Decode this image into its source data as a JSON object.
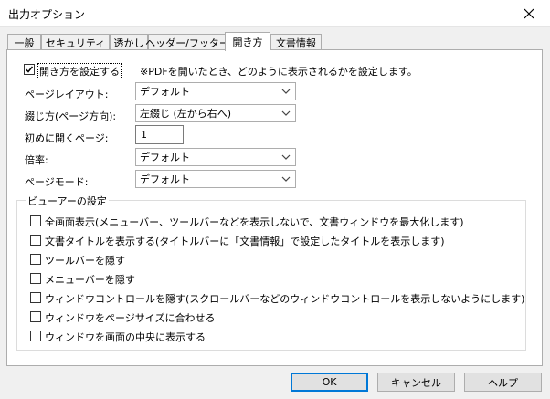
{
  "window": {
    "title": "出力オプション"
  },
  "tabs": [
    {
      "label": "一般"
    },
    {
      "label": "セキュリティ"
    },
    {
      "label": "透かし"
    },
    {
      "label": "ヘッダー/フッター"
    },
    {
      "label": "開き方",
      "active": true
    },
    {
      "label": "文書情報"
    }
  ],
  "open_settings": {
    "enable_label": "開き方を設定する",
    "enable_checked": true,
    "note": "※PDFを開いたとき、どのように表示されるかを設定します。",
    "page_layout_label": "ページレイアウト:",
    "page_layout_value": "デフォルト",
    "binding_label": "綴じ方(ページ方向):",
    "binding_value": "左綴じ (左から右へ)",
    "first_page_label": "初めに開くページ:",
    "first_page_value": "1",
    "zoom_label": "倍率:",
    "zoom_value": "デフォルト",
    "page_mode_label": "ページモード:",
    "page_mode_value": "デフォルト"
  },
  "viewer": {
    "group_title": "ビューアーの設定",
    "options": [
      {
        "label": "全画面表示(メニューバー、ツールバーなどを表示しないで、文書ウィンドウを最大化します)",
        "checked": false
      },
      {
        "label": "文書タイトルを表示する(タイトルバーに「文書情報」で設定したタイトルを表示します)",
        "checked": false
      },
      {
        "label": "ツールバーを隠す",
        "checked": false
      },
      {
        "label": "メニューバーを隠す",
        "checked": false
      },
      {
        "label": "ウィンドウコントロールを隠す(スクロールバーなどのウィンドウコントロールを表示しないようにします)",
        "checked": false
      },
      {
        "label": "ウィンドウをページサイズに合わせる",
        "checked": false
      },
      {
        "label": "ウィンドウを画面の中央に表示する",
        "checked": false
      }
    ]
  },
  "buttons": {
    "ok": "OK",
    "cancel": "キャンセル",
    "help": "ヘルプ"
  },
  "colors": {
    "accent": "#0078d7",
    "panel": "#ffffff",
    "background": "#f0f0f0"
  }
}
